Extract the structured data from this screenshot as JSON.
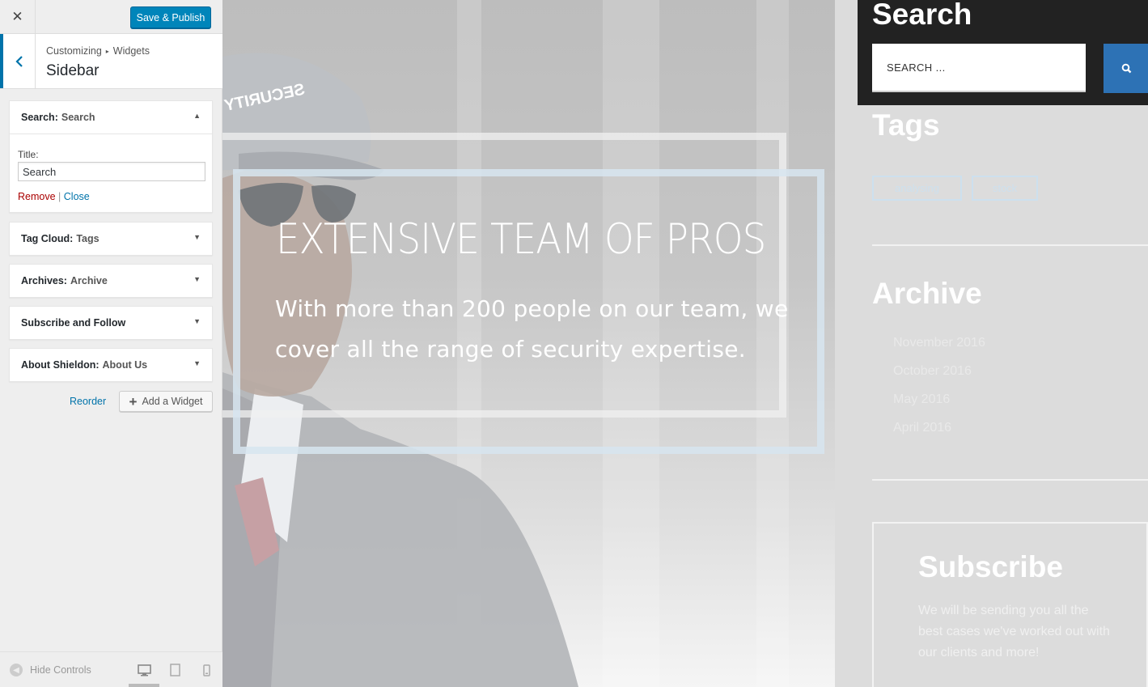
{
  "customizer": {
    "header": {
      "save_label": "Save & Publish"
    },
    "breadcrumb": {
      "root": "Customizing",
      "sep": "▸",
      "parent": "Widgets"
    },
    "section_title": "Sidebar",
    "widgets": [
      {
        "type": "Search:",
        "title": "Search",
        "expanded": true,
        "field_label": "Title:",
        "field_value": "Search",
        "remove_label": "Remove",
        "divider": "|",
        "close_label": "Close"
      },
      {
        "type": "Tag Cloud:",
        "title": "Tags"
      },
      {
        "type": "Archives:",
        "title": "Archive"
      },
      {
        "type": "Subscribe and Follow",
        "title": ""
      },
      {
        "type": "About Shieldon:",
        "title": "About Us"
      }
    ],
    "reorder_label": "Reorder",
    "add_widget_label": "Add a Widget",
    "footer": {
      "hide_controls_label": "Hide Controls"
    },
    "colors": {
      "accent": "#0085ba",
      "link": "#0073aa",
      "remove": "#aa0000"
    }
  },
  "preview": {
    "hero": {
      "title": "EXTENSIVE TEAM OF PROS",
      "text": "With more than 200 people on our team, we cover all the range of security expertise.",
      "cap_text": "SECURITY"
    },
    "sidebar": {
      "search": {
        "title": "Search",
        "placeholder": "SEARCH ..."
      },
      "tags": {
        "title": "Tags",
        "items": [
          "analysing",
          "stock"
        ]
      },
      "archive": {
        "title": "Archive",
        "items": [
          "November 2016",
          "October 2016",
          "May 2016",
          "April 2016"
        ]
      },
      "subscribe": {
        "title": "Subscribe",
        "text": "We will be sending you all the best cases we've worked out with our clients and more!"
      }
    },
    "colors": {
      "dark_block": "#222222",
      "search_button": "#2d72b5"
    }
  }
}
